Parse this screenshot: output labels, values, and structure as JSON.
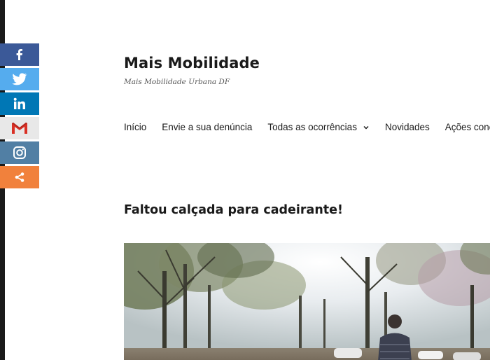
{
  "site": {
    "title": "Mais Mobilidade",
    "description": "Mais Mobilidade Urbana DF"
  },
  "nav": {
    "items": [
      {
        "label": "Início"
      },
      {
        "label": "Envie a sua denúncia"
      },
      {
        "label": "Todas as ocorrências",
        "has_submenu": true
      },
      {
        "label": "Novidades"
      },
      {
        "label": "Ações concluídas"
      }
    ]
  },
  "post": {
    "title": "Faltou calçada para cadeirante!"
  },
  "share": {
    "buttons": [
      {
        "icon": "facebook-icon",
        "color": "#3b5998"
      },
      {
        "icon": "twitter-icon",
        "color": "#55acee"
      },
      {
        "icon": "linkedin-icon",
        "color": "#0077b5"
      },
      {
        "icon": "gmail-icon",
        "color": "#e8e8e8"
      },
      {
        "icon": "instagram-icon",
        "color": "#517fa4"
      },
      {
        "icon": "share-icon",
        "color": "#f1813c"
      }
    ]
  }
}
